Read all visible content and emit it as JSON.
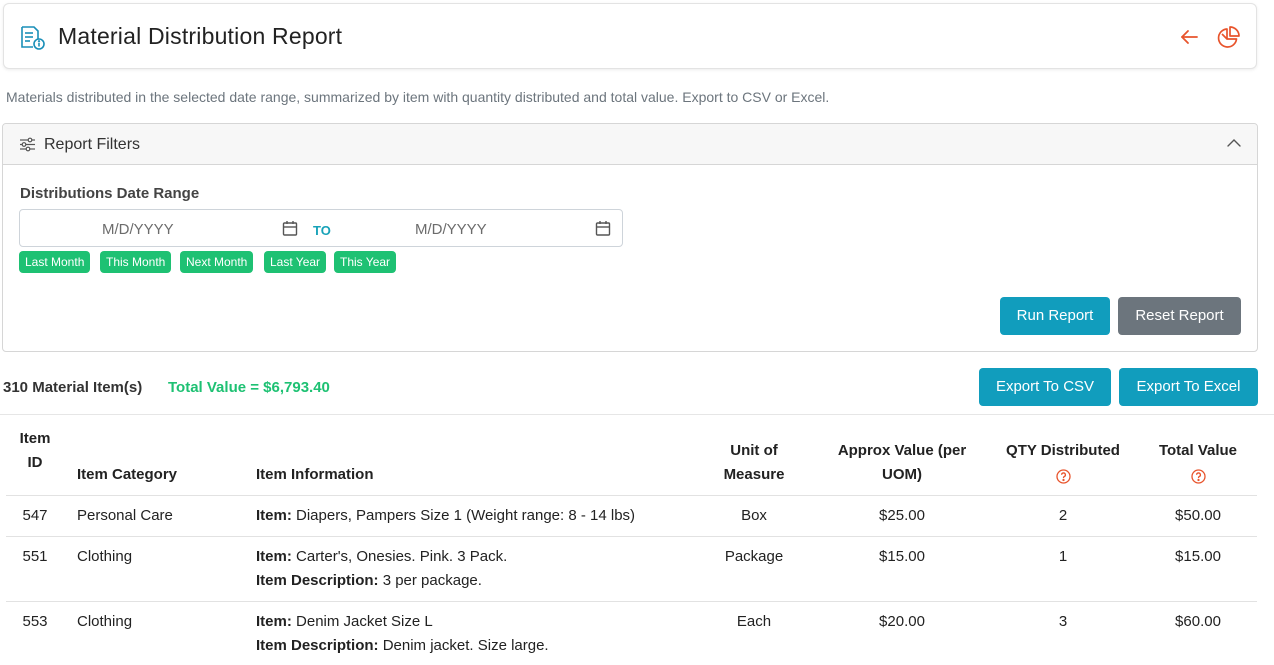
{
  "header": {
    "title": "Material Distribution Report",
    "icon": "report-icon",
    "accent_color": "#e8542c"
  },
  "description": "Materials distributed in the selected date range, summarized by item with quantity distributed and total value. Export to CSV or Excel.",
  "filters": {
    "title": "Report Filters",
    "range_label": "Distributions Date Range",
    "from_placeholder": "M/D/YYYY",
    "to_placeholder": "M/D/YYYY",
    "to_label": "TO",
    "quick_ranges": [
      "Last Month",
      "This Month",
      "Next Month",
      "Last Year",
      "This Year"
    ],
    "run_label": "Run Report",
    "reset_label": "Reset Report"
  },
  "summary": {
    "count_text": "310 Material Item(s)",
    "total_text": "Total Value = $6,793.40",
    "export_csv_label": "Export To CSV",
    "export_excel_label": "Export To Excel"
  },
  "table": {
    "headers": {
      "id_line1": "Item",
      "id_line2": "ID",
      "category": "Item Category",
      "info": "Item Information",
      "uom_line1": "Unit of",
      "uom_line2": "Measure",
      "value_line1": "Approx Value (per",
      "value_line2": "UOM)",
      "qty": "QTY Distributed",
      "total": "Total Value"
    },
    "item_prefix": "Item:",
    "desc_prefix": "Item Description:",
    "rows": [
      {
        "id": "547",
        "category": "Personal Care",
        "item": "Diapers, Pampers Size 1 (Weight range: 8 - 14 lbs)",
        "description": "",
        "uom": "Box",
        "value": "$25.00",
        "qty": "2",
        "total": "$50.00"
      },
      {
        "id": "551",
        "category": "Clothing",
        "item": "Carter's, Onesies. Pink. 3 Pack.",
        "description": "3 per package.",
        "uom": "Package",
        "value": "$15.00",
        "qty": "1",
        "total": "$15.00"
      },
      {
        "id": "553",
        "category": "Clothing",
        "item": "Denim Jacket Size L",
        "description": "Denim jacket. Size large.",
        "uom": "Each",
        "value": "$20.00",
        "qty": "3",
        "total": "$60.00"
      }
    ]
  }
}
